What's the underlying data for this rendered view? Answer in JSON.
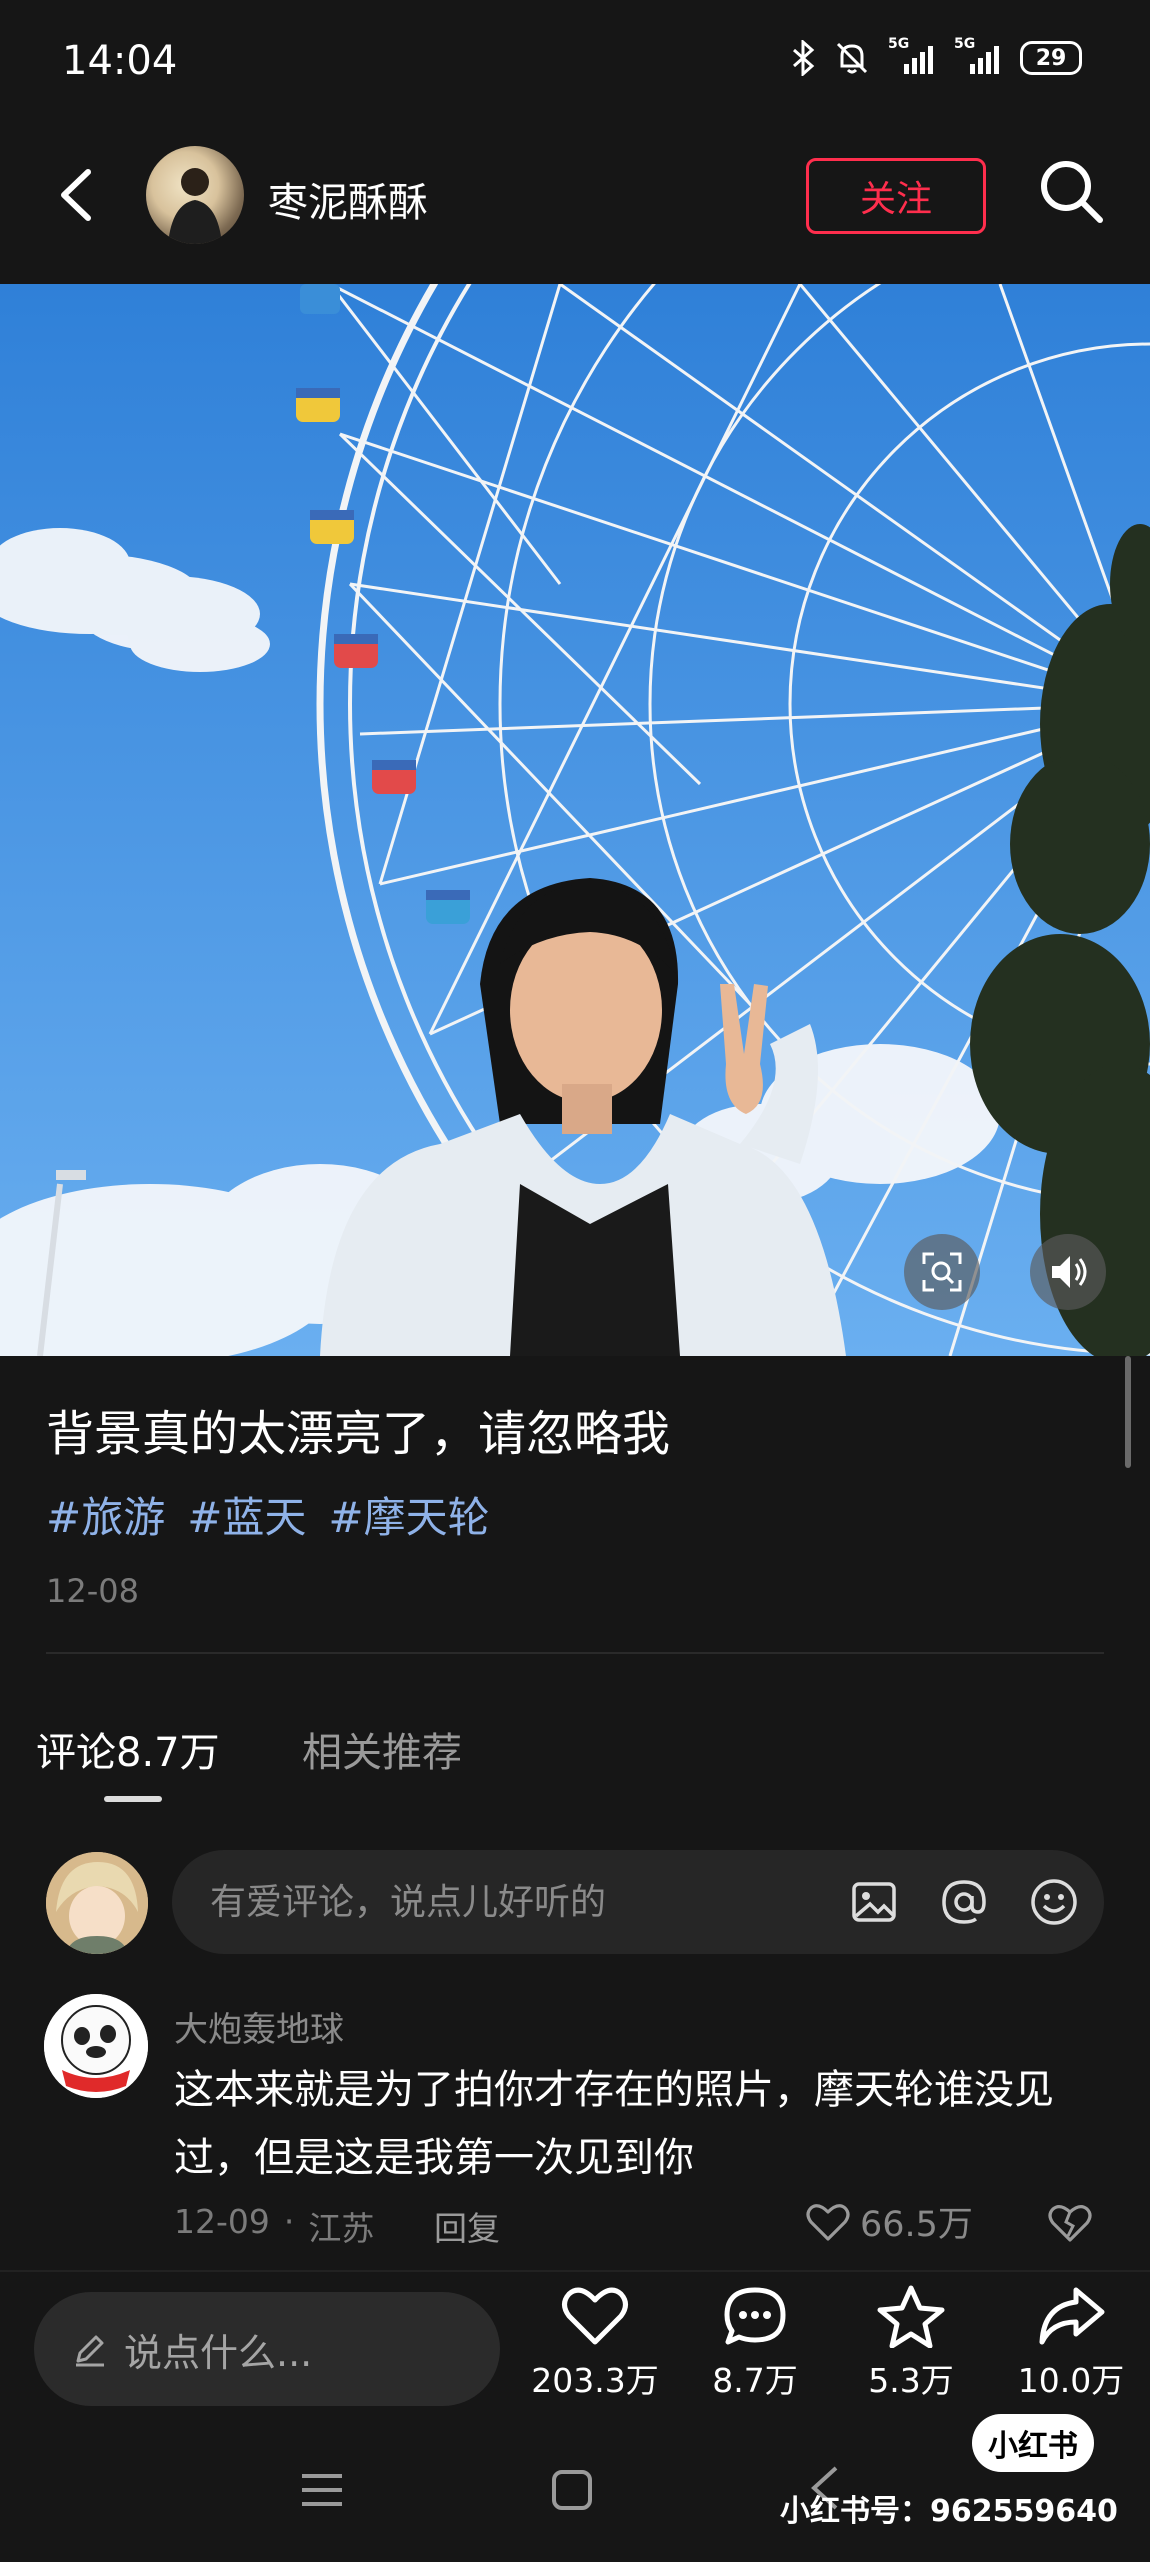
{
  "status_bar": {
    "time": "14:04",
    "network_left": "5G",
    "network_right": "5G",
    "battery": "29",
    "icons": [
      "bluetooth-icon",
      "mute-bell-icon",
      "signal-icon",
      "signal-icon",
      "battery-icon"
    ]
  },
  "header": {
    "username": "枣泥酥酥",
    "follow_label": "关注"
  },
  "photo": {
    "sky_color": "#3f8fe0"
  },
  "post": {
    "title": "背景真的太漂亮了，请忽略我",
    "tags": [
      "#旅游",
      "#蓝天",
      "#摩天轮"
    ],
    "date": "12-08"
  },
  "tabs": {
    "comments": "评论8.7万",
    "related": "相关推荐"
  },
  "comment_input": {
    "placeholder": "有爱评论，说点儿好听的"
  },
  "comment": {
    "author": "大炮轰地球",
    "text": "这本来就是为了拍你才存在的照片，摩天轮谁没见过，但是这是我第一次见到你",
    "date": "12-09",
    "location": "江苏",
    "reply_label": "回复",
    "likes": "66.5万"
  },
  "bottom_bar": {
    "say_placeholder": "说点什么...",
    "likes": "203.3万",
    "comments": "8.7万",
    "favorites": "5.3万",
    "shares": "10.0万"
  },
  "watermark": {
    "badge": "小红书",
    "id_text": "小红书号：962559640"
  },
  "colors": {
    "accent": "#ff2e4d",
    "tag": "#8fb2e8",
    "background": "#161616"
  }
}
